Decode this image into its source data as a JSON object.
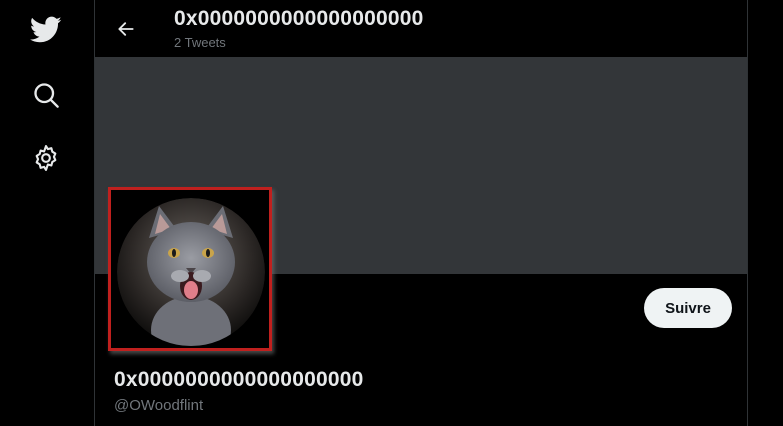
{
  "nav": {
    "items": [
      {
        "icon": "twitter-bird-icon"
      },
      {
        "icon": "search-icon"
      },
      {
        "icon": "gear-icon"
      }
    ]
  },
  "header": {
    "title": "0x0000000000000000000",
    "subtitle": "2 Tweets",
    "back_icon": "back-arrow-icon"
  },
  "profile": {
    "name": "0x0000000000000000000",
    "handle": "@OWoodflint",
    "follow_label": "Suivre",
    "avatar_subject": "grey-kitten"
  },
  "colors": {
    "background": "#000000",
    "banner": "#333639",
    "text_primary": "#e7e9ea",
    "text_secondary": "#71767b",
    "follow_button_bg": "#eff3f4",
    "highlight_border": "#c0201e"
  }
}
